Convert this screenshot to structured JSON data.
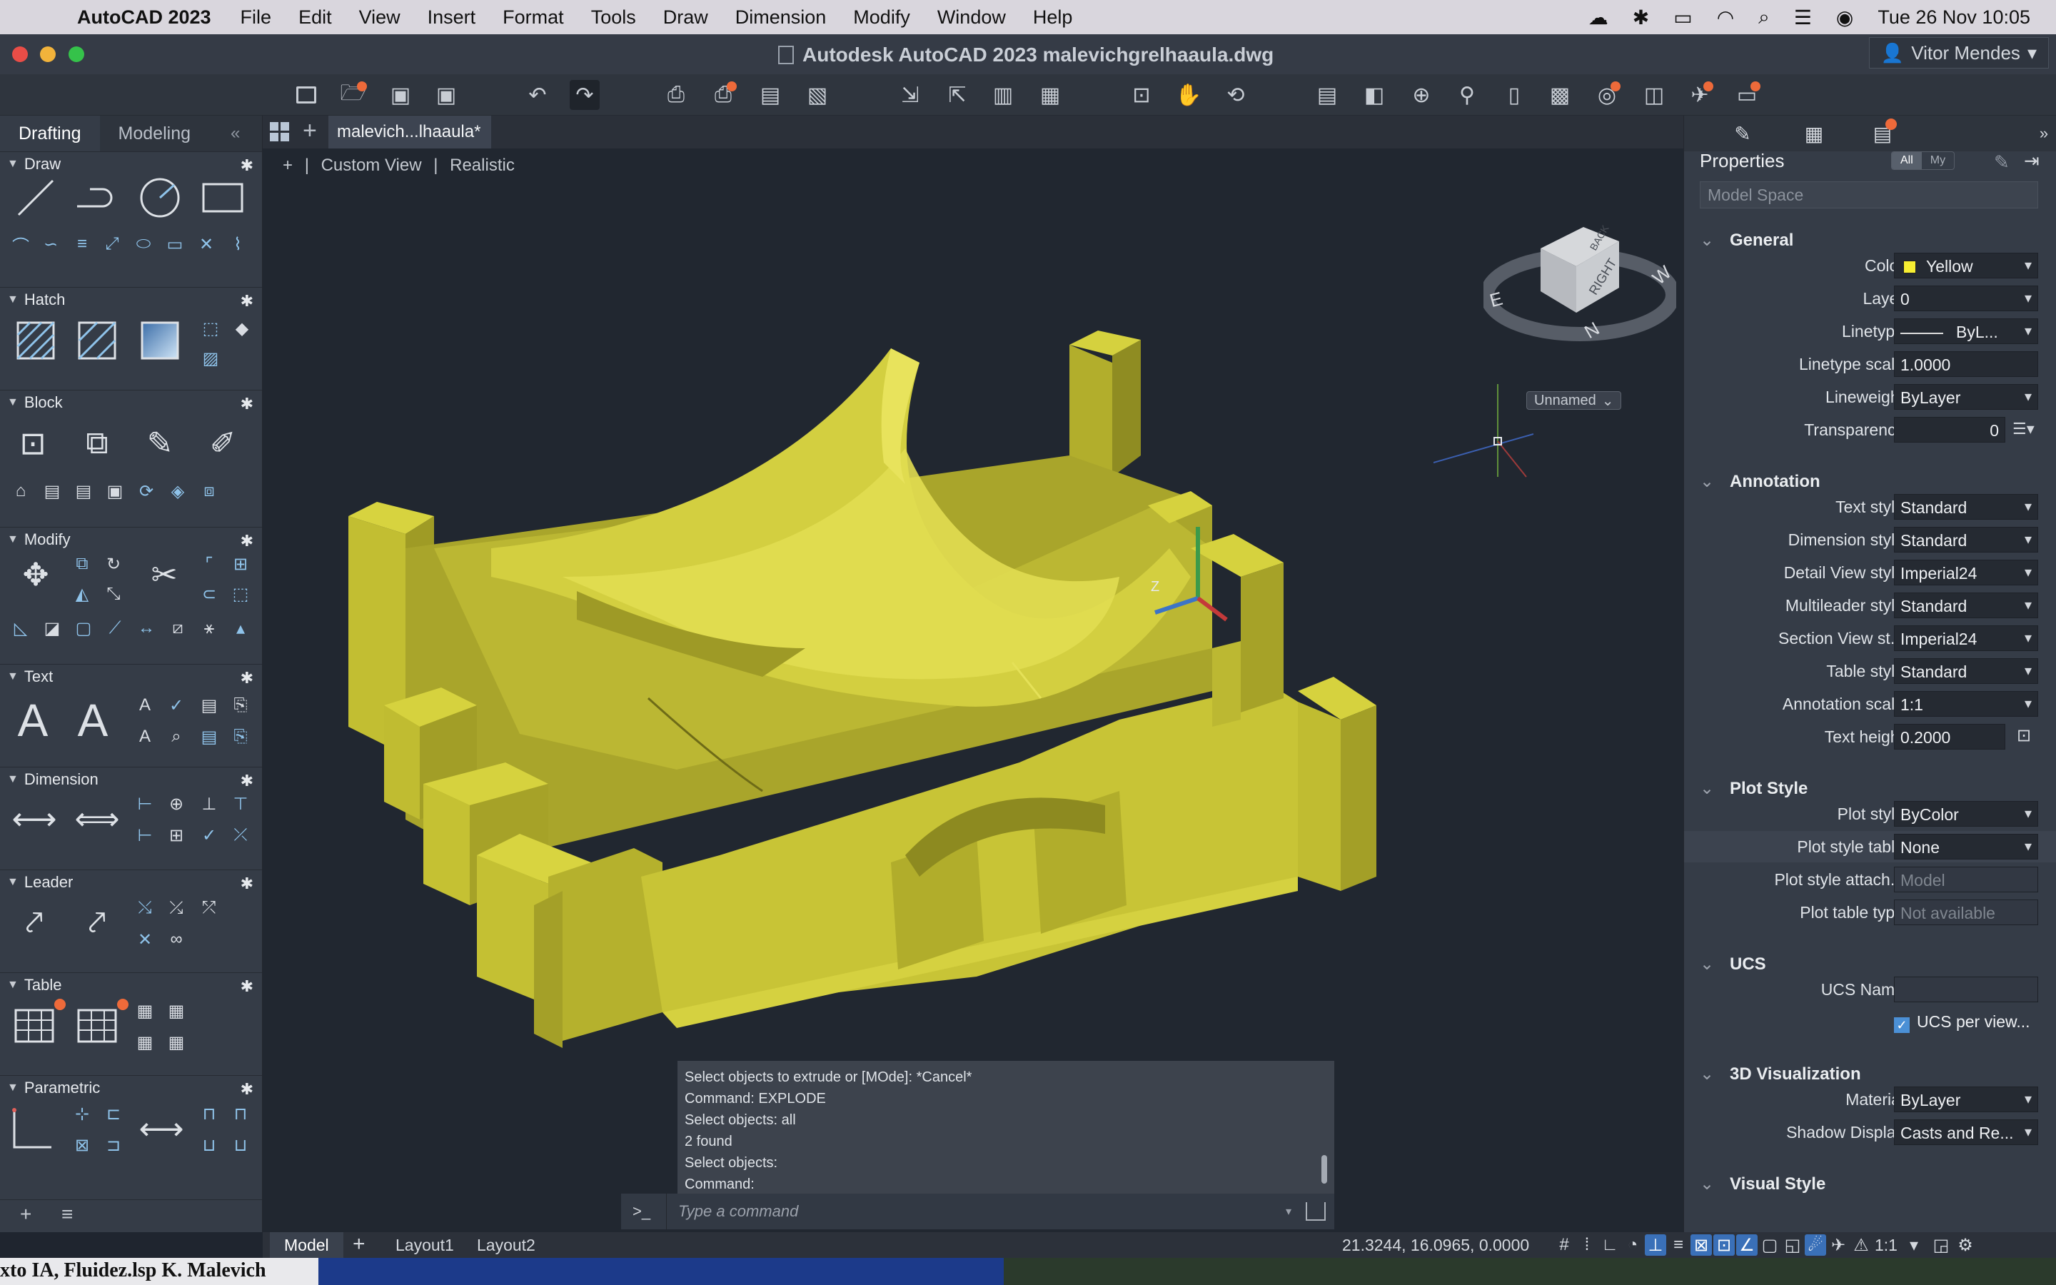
{
  "menubar": {
    "app_name": "AutoCAD 2023",
    "items": [
      "File",
      "Edit",
      "View",
      "Insert",
      "Format",
      "Tools",
      "Draw",
      "Dimension",
      "Modify",
      "Window",
      "Help"
    ],
    "clock": "Tue 26 Nov  10:05"
  },
  "window": {
    "title": "Autodesk AutoCAD 2023   malevichgrelhaaula.dwg",
    "user": "Vitor Mendes"
  },
  "left_panel": {
    "tabs": [
      "Drafting",
      "Modeling"
    ],
    "active_tab": "Drafting",
    "sections": {
      "draw": "Draw",
      "hatch": "Hatch",
      "block": "Block",
      "modify": "Modify",
      "text": "Text",
      "dimension": "Dimension",
      "leader": "Leader",
      "table": "Table",
      "parametric": "Parametric"
    }
  },
  "file_tab": {
    "label": "malevich...lhaaula*"
  },
  "viewport": {
    "view_label": "Custom View",
    "style_label": "Realistic",
    "ucs_label": "Unnamed",
    "viewcube_face": "RIGHT",
    "viewcube_top": "BACK",
    "compass": [
      "E",
      "N",
      "W"
    ],
    "object_color": "#c6c235"
  },
  "command": {
    "history": [
      "Select objects to extrude or [MOde]: *Cancel*",
      "Command: EXPLODE",
      "Select objects: all",
      "2 found",
      "Select objects:",
      "Command:"
    ],
    "prompt": ">_",
    "placeholder": "Type a command"
  },
  "properties": {
    "title": "Properties",
    "filter_all": "All",
    "filter_my": "My",
    "selection": "Model Space",
    "groups": {
      "general": "General",
      "annotation": "Annotation",
      "plot_style": "Plot Style",
      "ucs": "UCS",
      "visualization": "3D Visualization",
      "visual_style": "Visual Style"
    },
    "rows": {
      "color": {
        "label": "Color",
        "value": "Yellow"
      },
      "layer": {
        "label": "Layer",
        "value": "0"
      },
      "linetype": {
        "label": "Linetype",
        "value": "ByL..."
      },
      "linetype_scale": {
        "label": "Linetype scale",
        "value": "1.0000"
      },
      "lineweight": {
        "label": "Lineweight",
        "value": "ByLayer"
      },
      "transparency": {
        "label": "Transparency",
        "value": "0"
      },
      "text_style": {
        "label": "Text style",
        "value": "Standard"
      },
      "dimension_style": {
        "label": "Dimension style",
        "value": "Standard"
      },
      "detail_view_style": {
        "label": "Detail View style",
        "value": "Imperial24"
      },
      "multileader_style": {
        "label": "Multileader style",
        "value": "Standard"
      },
      "section_view_style": {
        "label": "Section View st...",
        "value": "Imperial24"
      },
      "table_style": {
        "label": "Table style",
        "value": "Standard"
      },
      "annotation_scale": {
        "label": "Annotation scale",
        "value": "1:1"
      },
      "text_height": {
        "label": "Text height",
        "value": "0.2000"
      },
      "plot_style": {
        "label": "Plot style",
        "value": "ByColor"
      },
      "plot_style_table": {
        "label": "Plot style table",
        "value": "None"
      },
      "plot_style_attach": {
        "label": "Plot style attach...",
        "value": "Model"
      },
      "plot_table_type": {
        "label": "Plot table type",
        "value": "Not available"
      },
      "ucs_name": {
        "label": "UCS Name",
        "value": ""
      },
      "ucs_per_view": {
        "label": "UCS per view..."
      },
      "material": {
        "label": "Material",
        "value": "ByLayer"
      },
      "shadow_display": {
        "label": "Shadow Display",
        "value": "Casts and Re..."
      }
    }
  },
  "statusbar": {
    "model": "Model",
    "layout1": "Layout1",
    "layout2": "Layout2",
    "coords": "21.3244, 16.0965, 0.0000",
    "scale": "1:1"
  },
  "desktop": {
    "caption": "xto IA, Fluidez.lsp K. Malevich"
  }
}
